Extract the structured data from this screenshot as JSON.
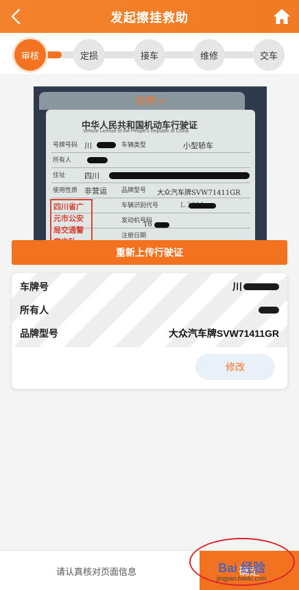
{
  "header": {
    "title": "发起擦挂救助"
  },
  "steps": [
    {
      "label": "审核",
      "active": true
    },
    {
      "label": "定损",
      "active": false
    },
    {
      "label": "接车",
      "active": false
    },
    {
      "label": "维修",
      "active": false
    },
    {
      "label": "交车",
      "active": false
    }
  ],
  "progress": 0.14,
  "photo": {
    "sample_label": "示例 >",
    "doc_title": "中华人民共和国机动车行驶证",
    "doc_subtitle": "Vehicle License of the People's Republic of China",
    "fields": {
      "plate_label": "号牌号码",
      "plate_value": "川",
      "type_label": "车辆类型",
      "type_value": "小型轿车",
      "owner_label": "所有人",
      "address_label": "住址",
      "address_value": "四川",
      "usage_label": "使用性质",
      "usage_value": "非营运",
      "model_label": "品牌型号",
      "model_value": "大众汽车牌SVW71411GR",
      "vin_label": "车辆识别代号",
      "vin_value": "L 2011",
      "engine_label": "发动机号码",
      "engine_value": "16",
      "register_label": "注册日期"
    },
    "stamp_text": "四川省广元市公安局交通警察支队"
  },
  "reupload_button": "重新上传行驶证",
  "info": {
    "rows": [
      {
        "key": "车牌号",
        "value": "川"
      },
      {
        "key": "所有人",
        "value": ""
      },
      {
        "key": "品牌型号",
        "value": "大众汽车牌SVW71411GR"
      }
    ],
    "edit_button": "修改"
  },
  "footer": {
    "hint": "请认真核对页面信息",
    "confirm_button": "确定"
  },
  "watermark": {
    "text": "Bai 经验",
    "url": "jingyan.baidu.com"
  },
  "colors": {
    "accent": "#f27220",
    "header": "#f3822c",
    "track": "#e2e2e2"
  }
}
